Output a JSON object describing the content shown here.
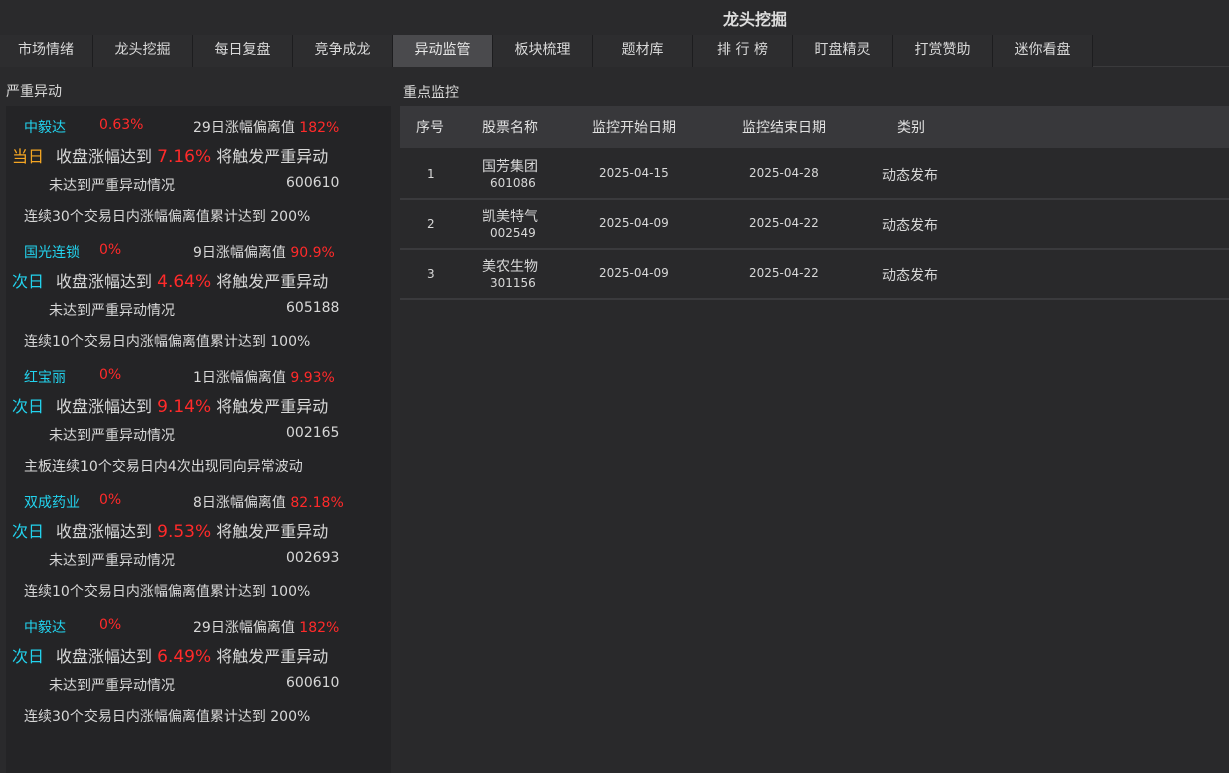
{
  "app": {
    "title": "龙头挖掘"
  },
  "tabs": [
    {
      "label": "市场情绪"
    },
    {
      "label": "龙头挖掘"
    },
    {
      "label": "每日复盘"
    },
    {
      "label": "竞争成龙"
    },
    {
      "label": "异动监管"
    },
    {
      "label": "板块梳理"
    },
    {
      "label": "题材库"
    },
    {
      "label": "排 行 榜"
    },
    {
      "label": "盯盘精灵"
    },
    {
      "label": "打赏赞助"
    },
    {
      "label": "迷你看盘"
    }
  ],
  "active_tab": "异动监管",
  "left": {
    "heading": "严重异动",
    "alerts": [
      {
        "name": "中毅达",
        "pct": "0.63%",
        "dev_label": "29日涨幅偏离值",
        "dev_value": "182%",
        "day": "当日",
        "pre": "收盘涨幅达到",
        "threshold": "7.16%",
        "post": "将触发严重异动",
        "status": "未达到严重异动情况",
        "code": "600610",
        "rule": "连续30个交易日内涨幅偏离值累计达到 200%"
      },
      {
        "name": "国光连锁",
        "pct": "0%",
        "dev_label": "9日涨幅偏离值",
        "dev_value": "90.9%",
        "day": "次日",
        "pre": "收盘涨幅达到",
        "threshold": "4.64%",
        "post": "将触发严重异动",
        "status": "未达到严重异动情况",
        "code": "605188",
        "rule": "连续10个交易日内涨幅偏离值累计达到 100%"
      },
      {
        "name": "红宝丽",
        "pct": "0%",
        "dev_label": "1日涨幅偏离值",
        "dev_value": "9.93%",
        "day": "次日",
        "pre": "收盘涨幅达到",
        "threshold": "9.14%",
        "post": "将触发严重异动",
        "status": "未达到严重异动情况",
        "code": "002165",
        "rule": "主板连续10个交易日内4次出现同向异常波动"
      },
      {
        "name": "双成药业",
        "pct": "0%",
        "dev_label": "8日涨幅偏离值",
        "dev_value": "82.18%",
        "day": "次日",
        "pre": "收盘涨幅达到",
        "threshold": "9.53%",
        "post": "将触发严重异动",
        "status": "未达到严重异动情况",
        "code": "002693",
        "rule": "连续10个交易日内涨幅偏离值累计达到 100%"
      },
      {
        "name": "中毅达",
        "pct": "0%",
        "dev_label": "29日涨幅偏离值",
        "dev_value": "182%",
        "day": "次日",
        "pre": "收盘涨幅达到",
        "threshold": "6.49%",
        "post": "将触发严重异动",
        "status": "未达到严重异动情况",
        "code": "600610",
        "rule": "连续30个交易日内涨幅偏离值累计达到 200%"
      }
    ]
  },
  "right": {
    "heading": "重点监控",
    "columns": [
      "序号",
      "股票名称",
      "监控开始日期",
      "监控结束日期",
      "类别"
    ],
    "rows": [
      {
        "idx": "1",
        "name": "国芳集团",
        "code": "601086",
        "start": "2025-04-15",
        "end": "2025-04-28",
        "category": "动态发布"
      },
      {
        "idx": "2",
        "name": "凯美特气",
        "code": "002549",
        "start": "2025-04-09",
        "end": "2025-04-22",
        "category": "动态发布"
      },
      {
        "idx": "3",
        "name": "美农生物",
        "code": "301156",
        "start": "2025-04-09",
        "end": "2025-04-22",
        "category": "动态发布"
      }
    ]
  },
  "colors": {
    "background": "#2a2a2c",
    "accent_cyan": "#22d3ee",
    "alert_red": "#ff2a2a",
    "today_orange": "#f5a623"
  }
}
